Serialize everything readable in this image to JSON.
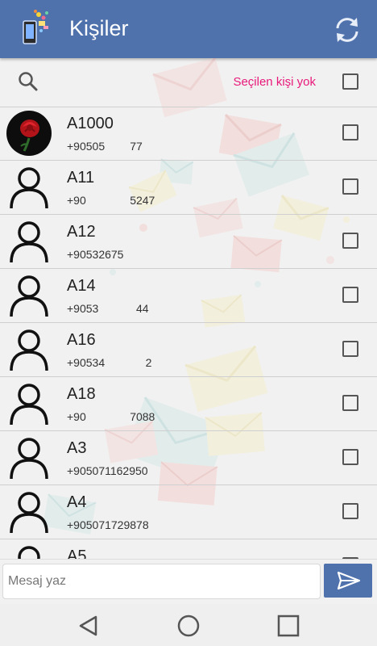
{
  "app": {
    "title": "Kişiler"
  },
  "search": {
    "status_text": "Seçilen kişi yok"
  },
  "contacts": [
    {
      "name": "A1000",
      "phone": "+90505        77",
      "avatar": "rose-photo"
    },
    {
      "name": "A11",
      "phone": "+90              5247",
      "avatar": "person-icon"
    },
    {
      "name": "A12",
      "phone": "+90532675",
      "avatar": "person-icon"
    },
    {
      "name": "A14",
      "phone": "+9053            44",
      "avatar": "person-icon"
    },
    {
      "name": "A16",
      "phone": "+90534             2",
      "avatar": "person-icon"
    },
    {
      "name": "A18",
      "phone": "+90              7088",
      "avatar": "person-icon"
    },
    {
      "name": "A3",
      "phone": "+905071162950",
      "avatar": "person-icon"
    },
    {
      "name": "A4",
      "phone": "+905071729878",
      "avatar": "person-icon"
    },
    {
      "name": "A5",
      "phone": "",
      "avatar": "person-icon"
    }
  ],
  "composer": {
    "placeholder": "Mesaj yaz"
  },
  "colors": {
    "appbar": "#4f72ad",
    "accent": "#e8197a",
    "background": "#f1f1f1"
  },
  "icons": {
    "logo": "phone-envelopes-icon",
    "refresh": "refresh-icon",
    "search": "search-icon",
    "send": "send-icon",
    "nav": [
      "back-triangle-icon",
      "home-circle-icon",
      "recents-square-icon"
    ]
  }
}
